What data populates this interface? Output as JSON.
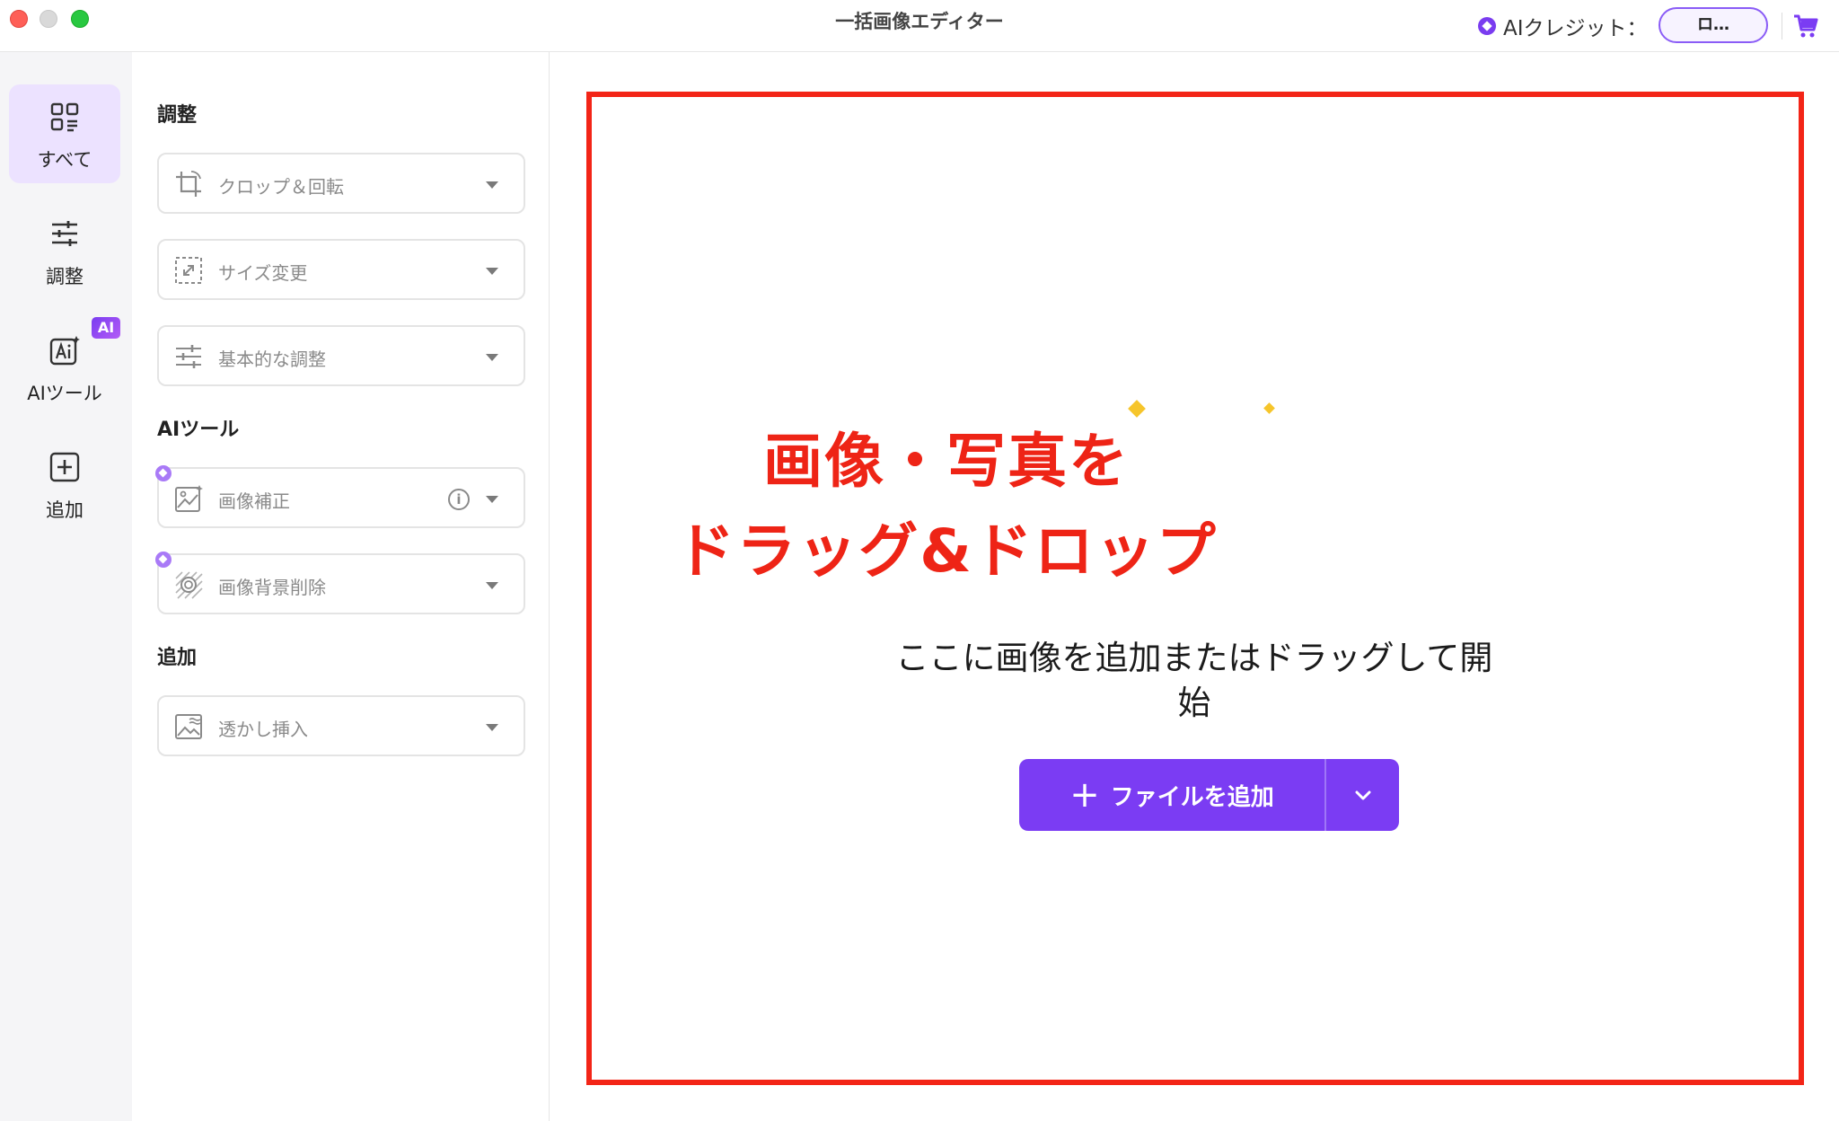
{
  "window": {
    "title": "一括画像エディター"
  },
  "titlebar": {
    "credit_label": "AIクレジット：",
    "login_label": "ロ…",
    "cart_icon": "cart-icon"
  },
  "rail": {
    "items": [
      {
        "label": "すべて",
        "icon": "grid-icon",
        "active": true
      },
      {
        "label": "調整",
        "icon": "sliders-icon",
        "active": false
      },
      {
        "label": "AIツール",
        "icon": "ai-icon",
        "active": false,
        "badge": "AI"
      },
      {
        "label": "追加",
        "icon": "plus-square-icon",
        "active": false
      }
    ]
  },
  "panel": {
    "sections": [
      {
        "title": "調整",
        "options": [
          {
            "label": "クロップ＆回転",
            "icon": "crop-rotate-icon"
          },
          {
            "label": "サイズ変更",
            "icon": "resize-icon"
          },
          {
            "label": "基本的な調整",
            "icon": "sliders-icon"
          }
        ]
      },
      {
        "title": "AIツール",
        "options": [
          {
            "label": "画像補正",
            "icon": "image-enhance-icon",
            "info": "i"
          },
          {
            "label": "画像背景削除",
            "icon": "background-remove-icon"
          }
        ]
      },
      {
        "title": "追加",
        "options": [
          {
            "label": "透かし挿入",
            "icon": "watermark-icon"
          }
        ]
      }
    ]
  },
  "dropzone": {
    "headline_line1": "画像・写真を",
    "headline_line2": "ドラッグ&ドロップ",
    "subtext": "ここに画像を追加またはドラッグして開始",
    "add_button_label": "ファイルを追加",
    "add_button_plus": "+"
  },
  "colors": {
    "accent": "#7b3cf3",
    "highlight_red": "#ee2416",
    "active_rail_bg": "#ece2ff"
  }
}
